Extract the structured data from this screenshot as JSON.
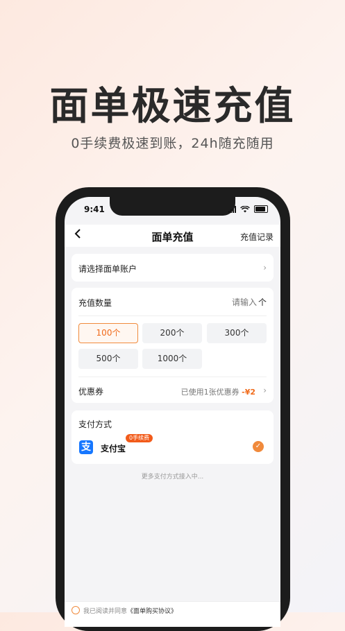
{
  "hero": {
    "title": "面单极速充值",
    "subtitle": "0手续费极速到账，24h随充随用"
  },
  "status_bar": {
    "time": "9:41"
  },
  "nav": {
    "back_icon": "chevron-left-icon",
    "title": "面单充值",
    "right_label": "充值记录"
  },
  "account": {
    "label": "请选择面单账户",
    "chevron": "›"
  },
  "quantity": {
    "label": "充值数量",
    "placeholder": "请输入",
    "unit": "个",
    "options": [
      "100个",
      "200个",
      "300个",
      "500个",
      "1000个"
    ],
    "selected_index": 0
  },
  "coupon": {
    "label": "优惠券",
    "used_text": "已使用1张优惠券",
    "amount": "-¥2",
    "chevron": "›"
  },
  "payment": {
    "label": "支付方式",
    "method_icon": "支",
    "method_name": "支付宝",
    "badge": "0手续费",
    "check": "✓"
  },
  "more_methods": "更多支付方式接入中...",
  "agreement": {
    "prefix": "我已阅读并同意",
    "link": "《面单购买协议》"
  },
  "colors": {
    "accent": "#f08a3c",
    "badge": "#f25b1a",
    "alipay": "#1677ff"
  }
}
